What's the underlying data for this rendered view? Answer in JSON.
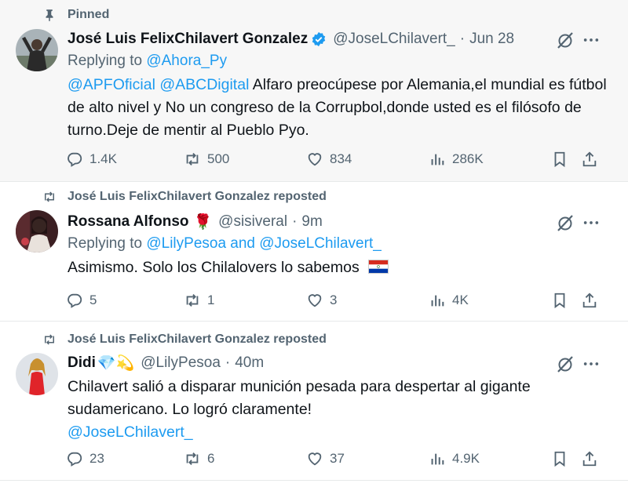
{
  "tweet1": {
    "pinned_label": "Pinned",
    "author_name": "José Luis FelixChilavert Gonzalez",
    "handle": "@JoseLChilavert_",
    "dot": "·",
    "time": "Jun 28",
    "replying_prefix": "Replying to ",
    "replying_to": "@Ahora_Py",
    "mention1": "@APFOficial",
    "mention2": "@ABCDigital",
    "text": " Alfaro preocúpese por Alemania,el mundial es fútbol de alto nivel y No un congreso de la Corrupbol,donde usted es el filósofo de turno.Deje de mentir al Pueblo Pyo.",
    "replies": "1.4K",
    "reposts": "500",
    "likes": "834",
    "views": "286K"
  },
  "tweet2": {
    "social_context": "José Luis FelixChilavert Gonzalez reposted",
    "author_name": "Rossana Alfonso",
    "name_emoji": "🌹",
    "handle": "@sisiveral",
    "dot": "·",
    "time": "9m",
    "replying_prefix": "Replying to ",
    "replying_to": "@LilyPesoa and @JoseLChilavert_",
    "text": "Asimismo. Solo los Chilalovers lo sabemos",
    "replies": "5",
    "reposts": "1",
    "likes": "3",
    "views": "4K"
  },
  "tweet3": {
    "social_context": "José Luis FelixChilavert Gonzalez reposted",
    "author_name": "Didi",
    "name_emoji": "💎💫",
    "handle": "@LilyPesoa",
    "dot": "·",
    "time": "40m",
    "text": "Chilavert salió a disparar munición pesada para despertar al gigante sudamericano. Lo logró claramente!",
    "mention": "@JoseLChilavert_",
    "replies": "23",
    "reposts": "6",
    "likes": "37",
    "views": "4.9K"
  },
  "colors": {
    "link": "#1d9bf0",
    "secondary_text": "#536471",
    "pinned_background": "#f7f7f7",
    "verified_badge": "#1d9bf0"
  }
}
